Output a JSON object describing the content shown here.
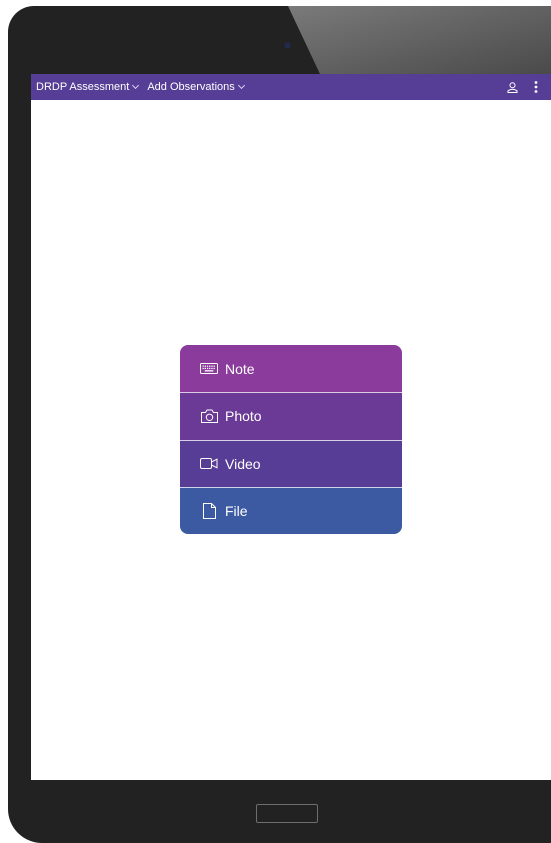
{
  "header": {
    "assessment_menu": "DRDP Assessment",
    "observations_menu": "Add Observations",
    "user_icon": "user-icon",
    "more_icon": "more-vertical-icon",
    "background_color": "#563e96"
  },
  "observation_types": [
    {
      "label": "Note",
      "icon": "keyboard-icon",
      "color": "#8a3b9c"
    },
    {
      "label": "Photo",
      "icon": "camera-icon",
      "color": "#6b3a96"
    },
    {
      "label": "Video",
      "icon": "video-icon",
      "color": "#573d96"
    },
    {
      "label": "File",
      "icon": "file-icon",
      "color": "#3b5aa2"
    }
  ]
}
